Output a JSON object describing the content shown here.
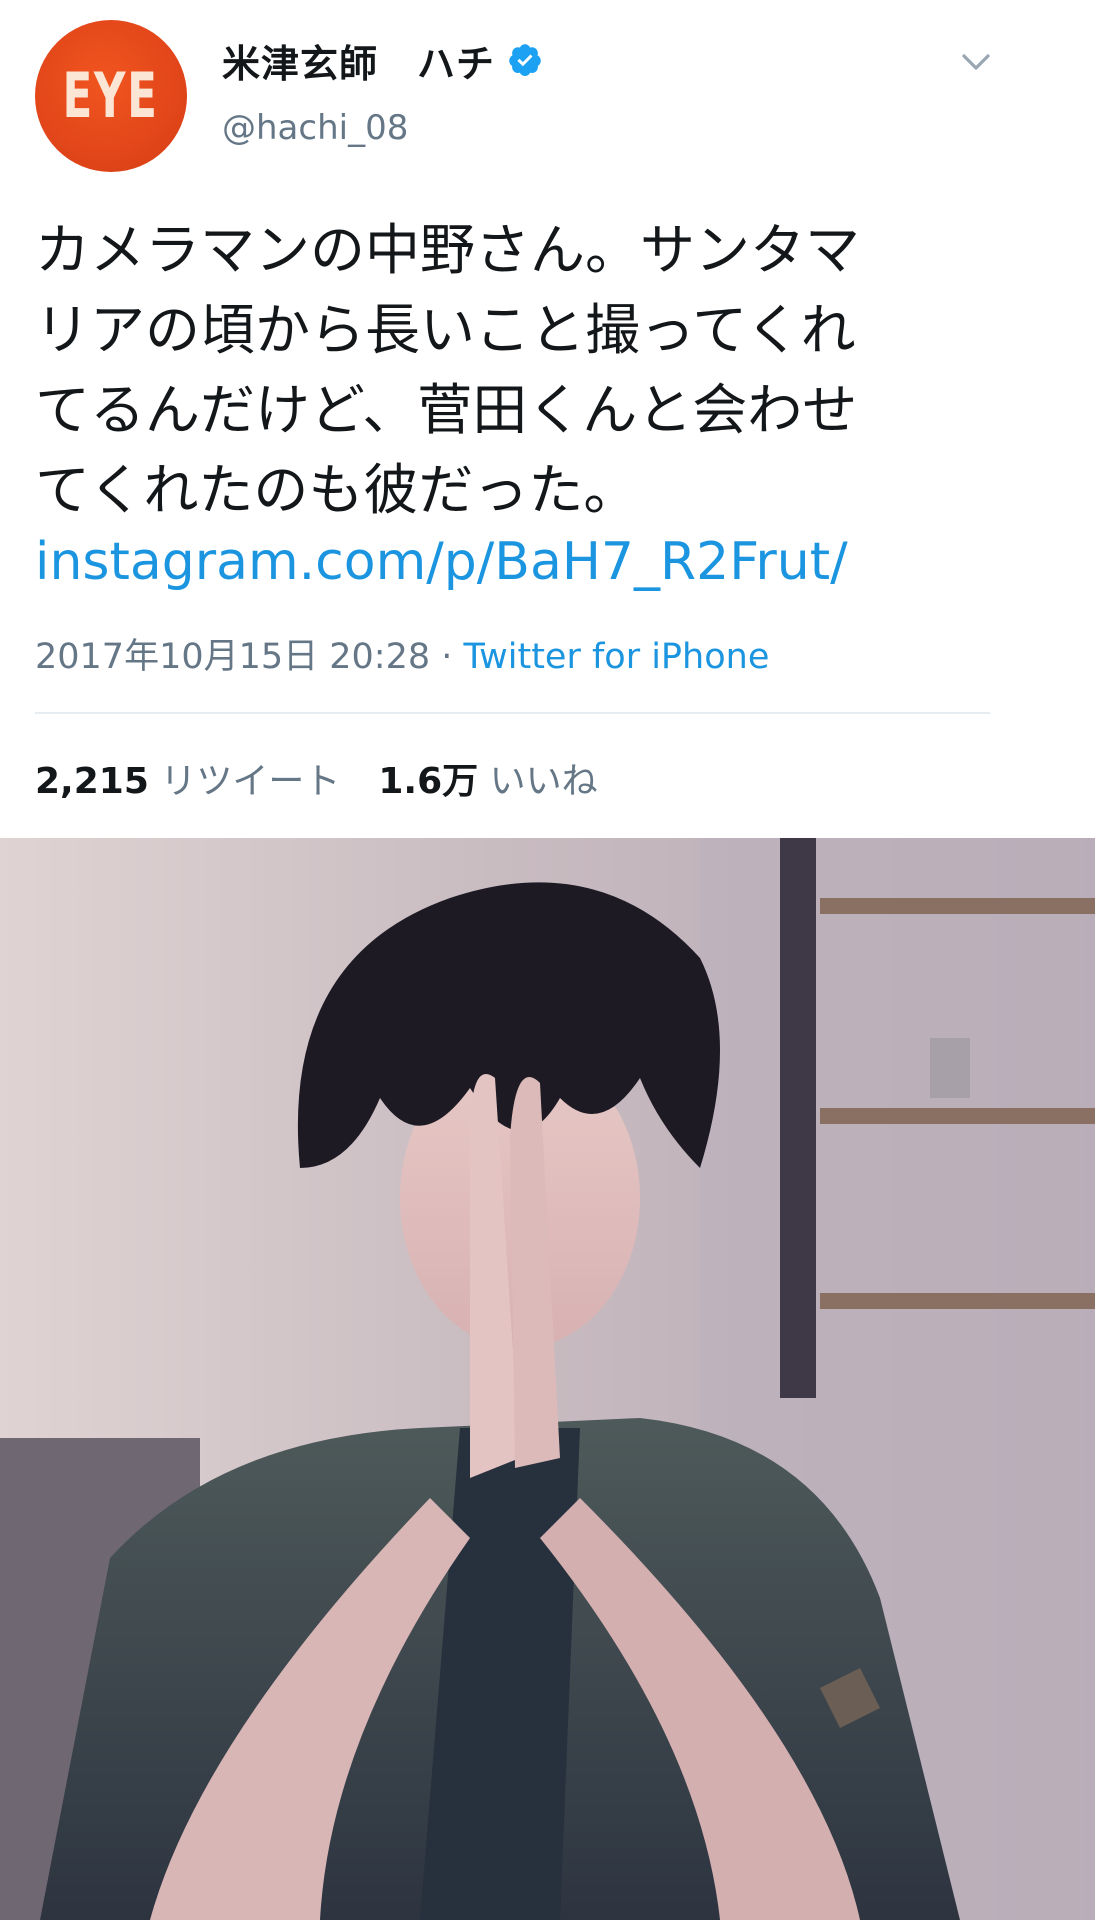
{
  "tweet": {
    "avatar_text": "EYE",
    "display_name": "米津玄師　ハチ",
    "handle": "@hachi_08",
    "text_lines": [
      "カメラマンの中野さん。サンタマ",
      "リアの頃から長いこと撮ってくれ",
      "てるんだけど、菅田くんと会わせ",
      "てくれたのも彼だった。"
    ],
    "link": "instagram.com/p/BaH7_R2Frut/",
    "timestamp": "2017年10月15日 20:28",
    "separator": " · ",
    "source": "Twitter for iPhone",
    "retweets_count": "2,215",
    "retweets_label": "リツイート",
    "likes_count": "1.6万",
    "likes_label": "いいね"
  },
  "icons": {
    "verified": "verified-badge-icon",
    "menu": "chevron-down-icon"
  },
  "colors": {
    "avatar": "#e2461a",
    "link": "#1b95e0",
    "secondary_text": "#657786",
    "primary_text": "#14171a",
    "divider": "#e6ecf0"
  }
}
